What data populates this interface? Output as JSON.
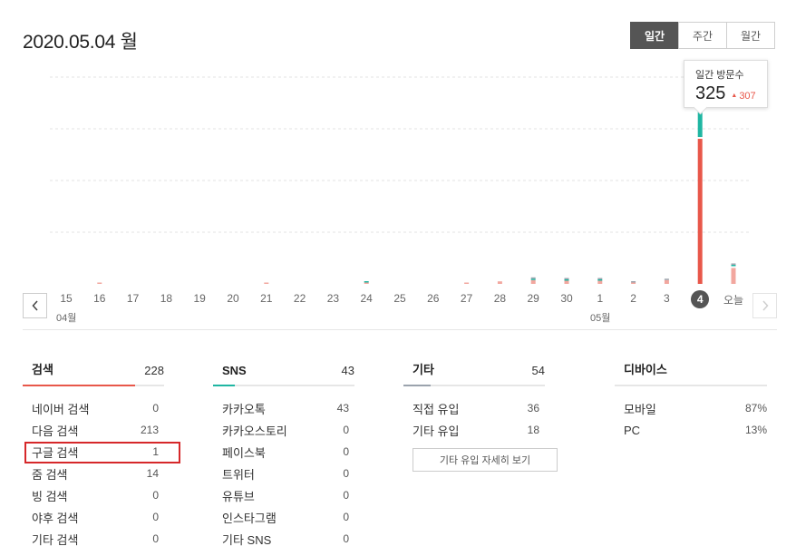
{
  "header": {
    "title": "2020.05.04 월"
  },
  "period_tabs": [
    {
      "label": "일간",
      "active": true
    },
    {
      "label": "주간",
      "active": false
    },
    {
      "label": "월간",
      "active": false
    }
  ],
  "tooltip": {
    "label": "일간 방문수",
    "value": "325",
    "diff": "307"
  },
  "colors": {
    "search": "#e8574a",
    "sns": "#1fb6a2",
    "other": "#9ba3ad",
    "light_search": "#f2a79f",
    "accent_active": "#555555",
    "highlight": "#d6282a"
  },
  "chart_data": {
    "type": "bar",
    "stacked": true,
    "categories": [
      "15",
      "16",
      "17",
      "18",
      "19",
      "20",
      "21",
      "22",
      "23",
      "24",
      "25",
      "26",
      "27",
      "28",
      "29",
      "30",
      "1",
      "2",
      "3",
      "4",
      "오늘"
    ],
    "active_category": "4",
    "ylim": [
      0,
      325
    ],
    "grid": true,
    "series": [
      {
        "key": "search",
        "values": [
          0,
          1,
          0,
          0,
          0,
          0,
          1,
          0,
          0,
          1,
          0,
          0,
          1,
          4,
          6,
          5,
          5,
          2,
          6,
          228,
          25
        ]
      },
      {
        "key": "sns",
        "values": [
          0,
          0,
          0,
          0,
          0,
          0,
          0,
          0,
          0,
          1,
          0,
          0,
          0,
          0,
          1,
          1,
          1,
          0,
          0,
          43,
          1
        ]
      },
      {
        "key": "other",
        "values": [
          0,
          0,
          0,
          0,
          0,
          0,
          0,
          0,
          0,
          0,
          0,
          0,
          0,
          0,
          1,
          1,
          1,
          1,
          1,
          54,
          2
        ]
      }
    ]
  },
  "axis": {
    "month_labels": [
      {
        "text": "04월"
      },
      {
        "text": "05월"
      }
    ]
  },
  "stats": {
    "search": {
      "title": "검색",
      "total": "228",
      "rows": [
        {
          "label": "네이버 검색",
          "value": "0"
        },
        {
          "label": "다음 검색",
          "value": "213"
        },
        {
          "label": "구글 검색",
          "value": "1"
        },
        {
          "label": "줌 검색",
          "value": "14"
        },
        {
          "label": "빙 검색",
          "value": "0"
        },
        {
          "label": "야후 검색",
          "value": "0"
        },
        {
          "label": "기타 검색",
          "value": "0"
        }
      ]
    },
    "sns": {
      "title": "SNS",
      "total": "43",
      "rows": [
        {
          "label": "카카오톡",
          "value": "43"
        },
        {
          "label": "카카오스토리",
          "value": "0"
        },
        {
          "label": "페이스북",
          "value": "0"
        },
        {
          "label": "트위터",
          "value": "0"
        },
        {
          "label": "유튜브",
          "value": "0"
        },
        {
          "label": "인스타그램",
          "value": "0"
        },
        {
          "label": "기타 SNS",
          "value": "0"
        }
      ]
    },
    "other": {
      "title": "기타",
      "total": "54",
      "rows": [
        {
          "label": "직접 유입",
          "value": "36"
        },
        {
          "label": "기타 유입",
          "value": "18"
        }
      ],
      "more_label": "기타 유입 자세히 보기"
    },
    "device": {
      "title": "디바이스",
      "rows": [
        {
          "label": "모바일",
          "value": "87%"
        },
        {
          "label": "PC",
          "value": "13%"
        }
      ]
    }
  }
}
